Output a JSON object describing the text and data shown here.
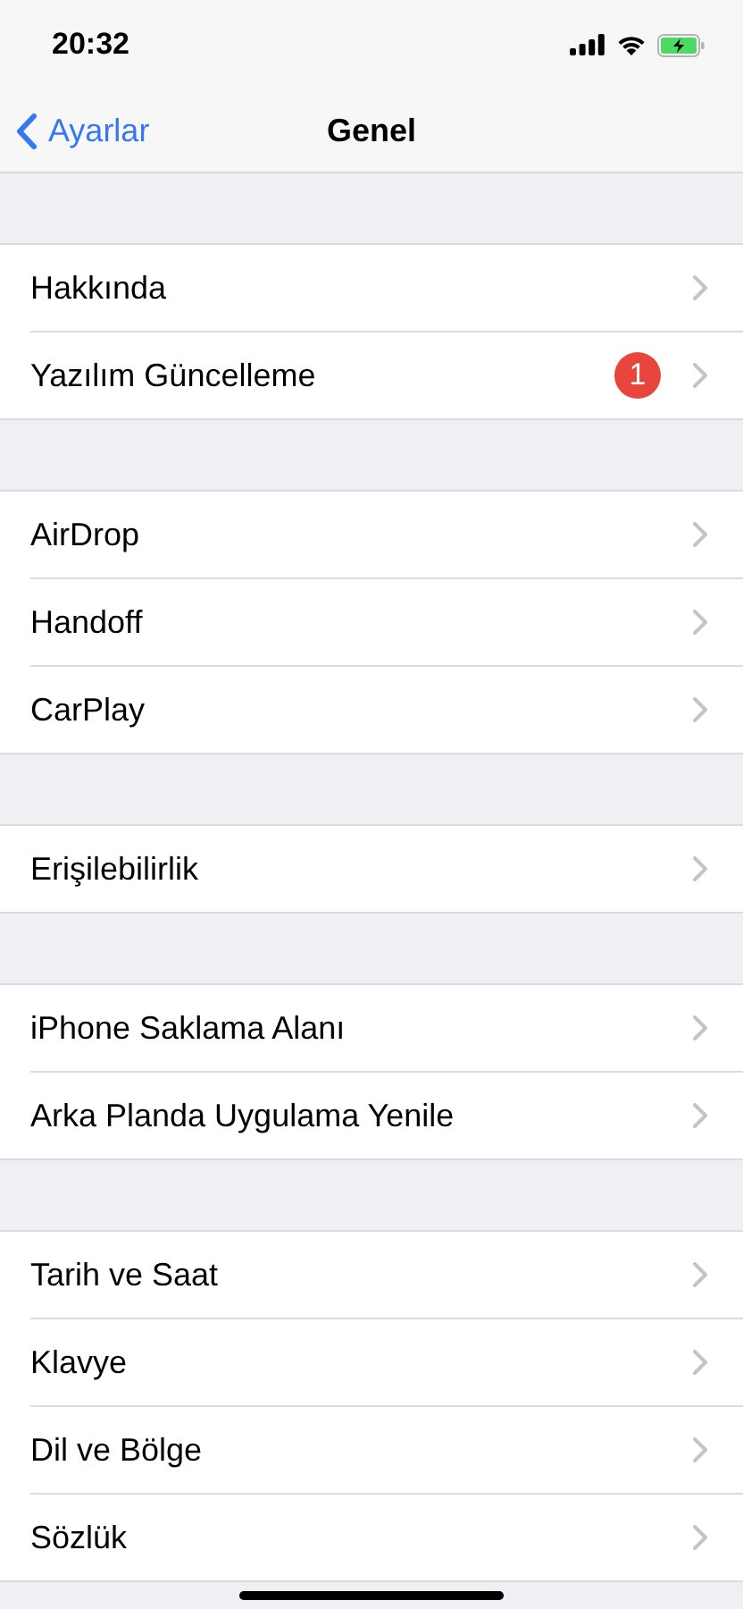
{
  "status_bar": {
    "time": "20:32"
  },
  "nav_bar": {
    "back_label": "Ayarlar",
    "title": "Genel"
  },
  "sections": [
    {
      "rows": [
        {
          "label": "Hakkında"
        },
        {
          "label": "Yazılım Güncelleme",
          "badge": "1"
        }
      ]
    },
    {
      "rows": [
        {
          "label": "AirDrop"
        },
        {
          "label": "Handoff"
        },
        {
          "label": "CarPlay"
        }
      ]
    },
    {
      "rows": [
        {
          "label": "Erişilebilirlik"
        }
      ]
    },
    {
      "rows": [
        {
          "label": "iPhone Saklama Alanı"
        },
        {
          "label": "Arka Planda Uygulama Yenile"
        }
      ]
    },
    {
      "rows": [
        {
          "label": "Tarih ve Saat"
        },
        {
          "label": "Klavye"
        },
        {
          "label": "Dil ve Bölge"
        },
        {
          "label": "Sözlük"
        }
      ]
    }
  ]
}
